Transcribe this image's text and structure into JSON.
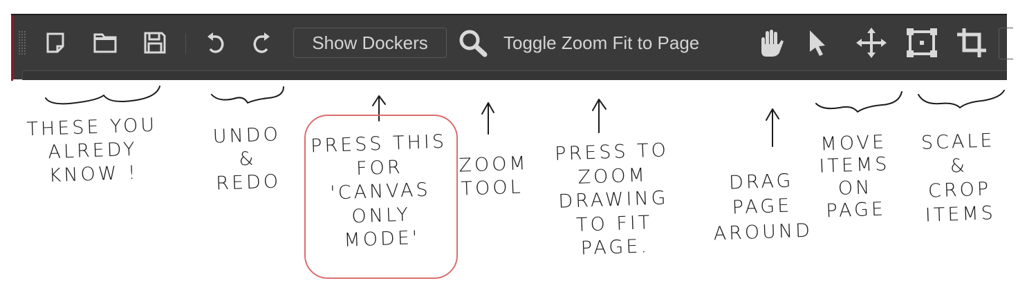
{
  "toolbar": {
    "tools": [
      {
        "icon": "new-document-icon"
      },
      {
        "icon": "open-folder-icon"
      },
      {
        "icon": "save-disk-icon"
      },
      {
        "icon": "undo-icon"
      },
      {
        "icon": "redo-icon"
      },
      {
        "icon": "zoom-magnifier-icon"
      },
      {
        "icon": "hand-pan-icon"
      },
      {
        "icon": "arrow-pointer-icon"
      },
      {
        "icon": "move-arrows-icon"
      },
      {
        "icon": "scale-transform-icon"
      },
      {
        "icon": "crop-icon"
      }
    ],
    "show_dockers_label": "Show Dockers",
    "toggle_zoom_label": "Toggle Zoom Fit to Page"
  },
  "annotations": {
    "file_tools": [
      "THESE YOU",
      "ALREDY",
      "KNOW !"
    ],
    "undo_redo": [
      "UNDO",
      "&",
      "REDO"
    ],
    "show_dockers": [
      "PRESS THIS",
      "FOR",
      "'CANVAS",
      "ONLY",
      "MODE'"
    ],
    "zoom_tool": [
      "ZOOM",
      "TOOL"
    ],
    "zoom_fit": [
      "PRESS TO",
      "ZOOM",
      "DRAWING",
      "TO FIT",
      "PAGE."
    ],
    "pan": [
      "DRAG",
      "PAGE",
      "AROUND"
    ],
    "move": [
      "MOVE",
      "ITEMS",
      "ON",
      "PAGE"
    ],
    "scale_crop": [
      "SCALE",
      "&",
      "CROP",
      "ITEMS"
    ]
  },
  "colors": {
    "toolbar_bg": "#3a3a3a",
    "icon": "#d9d9d9",
    "accent_left": "#8a1d2e",
    "highlight_circle": "#d96d6d",
    "ink": "#1a1a1a"
  }
}
